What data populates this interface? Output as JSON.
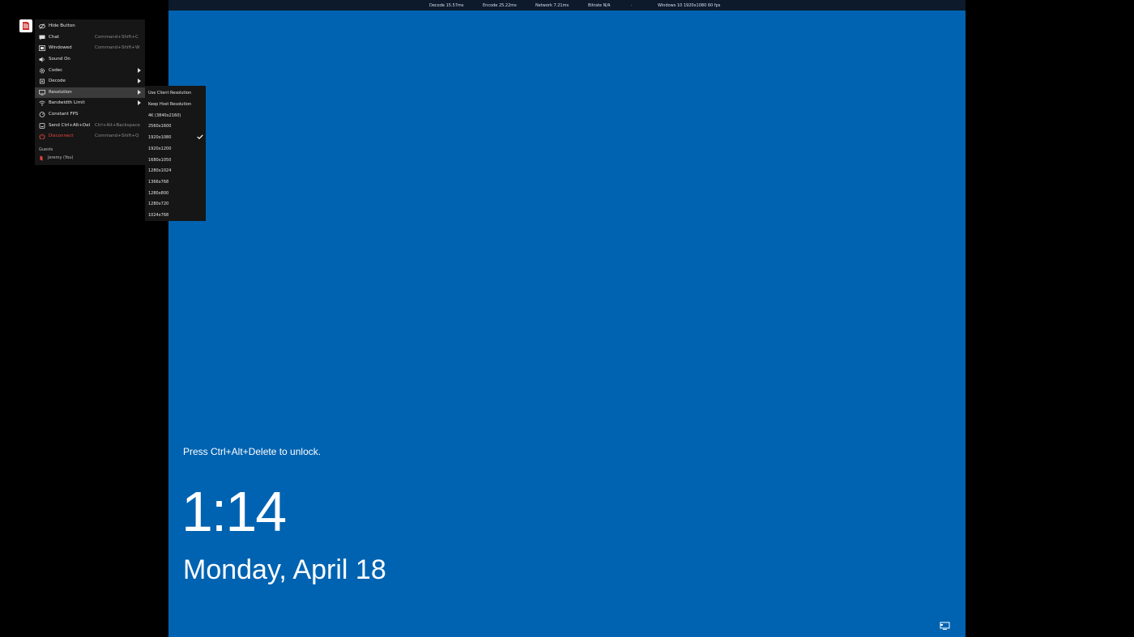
{
  "stats_bar": {
    "items": [
      "Decode 15.57ms",
      "Encode 25.22ms",
      "Network 7.21ms",
      "Bitrate N/A",
      "·",
      "Windows 10 1920x1080 60 fps"
    ]
  },
  "menu": {
    "items": [
      {
        "label": "Hide Button",
        "shortcut": "",
        "icon": "eye-off-icon",
        "arrow": false,
        "active": false,
        "red": false
      },
      {
        "label": "Chat",
        "shortcut": "Command+Shift+C",
        "icon": "chat-icon",
        "arrow": false,
        "active": false,
        "red": false
      },
      {
        "label": "Windowed",
        "shortcut": "Command+Shift+W",
        "icon": "window-icon",
        "arrow": false,
        "active": false,
        "red": false
      },
      {
        "label": "Sound On",
        "shortcut": "",
        "icon": "speaker-icon",
        "arrow": false,
        "active": false,
        "red": false
      },
      {
        "label": "Codec",
        "shortcut": "",
        "icon": "settings-icon",
        "arrow": true,
        "active": false,
        "red": false
      },
      {
        "label": "Decode",
        "shortcut": "",
        "icon": "chip-icon",
        "arrow": true,
        "active": false,
        "red": false
      },
      {
        "label": "Resolution",
        "shortcut": "",
        "icon": "monitor-icon",
        "arrow": true,
        "active": true,
        "red": false
      },
      {
        "label": "Bandwidth Limit",
        "shortcut": "",
        "icon": "wifi-icon",
        "arrow": true,
        "active": false,
        "red": false
      },
      {
        "label": "Constant FPS",
        "shortcut": "",
        "icon": "gauge-icon",
        "arrow": false,
        "active": false,
        "red": false
      },
      {
        "label": "Send Ctrl+Alt+Del",
        "shortcut": "Ctrl+Alt+Backspace",
        "icon": "keyboard-icon",
        "arrow": false,
        "active": false,
        "red": false
      },
      {
        "label": "Disconnect",
        "shortcut": "Command+Shift+Q",
        "icon": "power-icon",
        "arrow": false,
        "active": false,
        "red": true
      }
    ],
    "guests_header": "Guests",
    "guest": "Jeremy (You)"
  },
  "resolution_submenu": {
    "items": [
      {
        "label": "Use Client Resolution",
        "checked": false
      },
      {
        "label": "Keep Host Resolution",
        "checked": false
      },
      {
        "label": "4K (3840x2160)",
        "checked": false
      },
      {
        "label": "2560x1600",
        "checked": false
      },
      {
        "label": "1920x1080",
        "checked": true
      },
      {
        "label": "1920x1200",
        "checked": false
      },
      {
        "label": "1680x1050",
        "checked": false
      },
      {
        "label": "1280x1024",
        "checked": false
      },
      {
        "label": "1366x768",
        "checked": false
      },
      {
        "label": "1280x800",
        "checked": false
      },
      {
        "label": "1280x720",
        "checked": false
      },
      {
        "label": "1024x768",
        "checked": false
      }
    ]
  },
  "lock_screen": {
    "prompt": "Press Ctrl+Alt+Delete to unlock.",
    "time": "1:14",
    "date": "Monday, April 18"
  },
  "colors": {
    "lock_bg": "#0063b1",
    "menu_bg": "#161616",
    "accent_red": "#e8453c"
  }
}
